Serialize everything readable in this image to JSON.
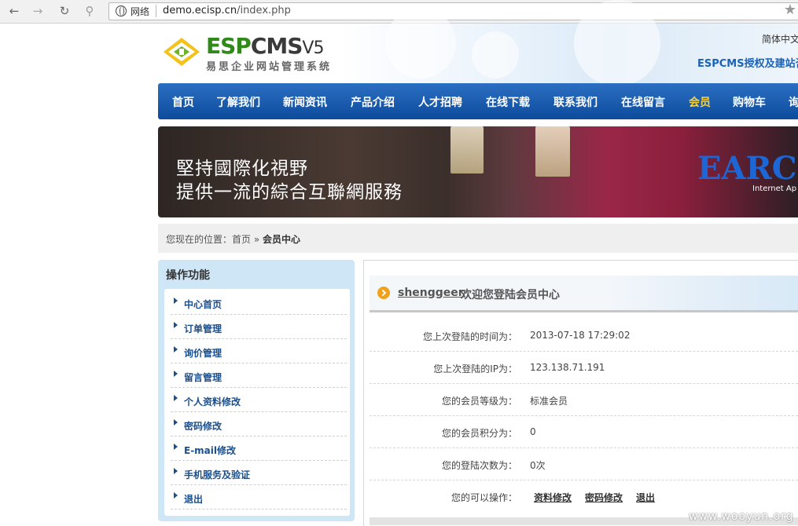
{
  "browser": {
    "site_label": "网络",
    "url_host": "demo.ecisp.cn",
    "url_path": "/index.php"
  },
  "header": {
    "logo_esp": "ESP",
    "logo_cms": "CMS",
    "logo_version": "V5",
    "logo_subtitle": "易思企业网站管理系统",
    "language": "简体中文",
    "auth_link": "ESPCMS授权及建站咨"
  },
  "nav": {
    "items": [
      {
        "label": "首页"
      },
      {
        "label": "了解我们"
      },
      {
        "label": "新闻资讯"
      },
      {
        "label": "产品介绍"
      },
      {
        "label": "人才招聘"
      },
      {
        "label": "在线下载"
      },
      {
        "label": "联系我们"
      },
      {
        "label": "在线留言"
      },
      {
        "label": "会员",
        "active": true
      },
      {
        "label": "购物车"
      },
      {
        "label": "询"
      }
    ],
    "active_color": "#f7d23b"
  },
  "banner": {
    "line1": "堅持國際化視野",
    "line2": "提供一流的綜合互聯網服務",
    "brand": "EARC",
    "brand_sub": "Internet Ap"
  },
  "breadcrumb": {
    "prefix": "您现在的位置：",
    "home": "首页",
    "sep": "»",
    "current": "会员中心"
  },
  "sidebar": {
    "title": "操作功能",
    "items": [
      {
        "label": "中心首页"
      },
      {
        "label": "订单管理"
      },
      {
        "label": "询价管理"
      },
      {
        "label": "留言管理"
      },
      {
        "label": "个人资料修改"
      },
      {
        "label": "密码修改"
      },
      {
        "label": "E-mail修改"
      },
      {
        "label": "手机服务及验证"
      },
      {
        "label": "退出"
      }
    ]
  },
  "main": {
    "username": "shenggeer",
    "welcome_msg": "欢迎您登陆会员中心",
    "rows": [
      {
        "label": "您上次登陆的时间为：",
        "value": "2013-07-18 17:29:02"
      },
      {
        "label": "您上次登陆的IP为：",
        "value": "123.138.71.191"
      },
      {
        "label": "您的会员等级为：",
        "value": "标准会员"
      },
      {
        "label": "您的会员积分为：",
        "value": "0"
      },
      {
        "label": "您的登陆次数为：",
        "value": "0次"
      }
    ],
    "ops_label": "您的可以操作：",
    "ops": [
      "资料修改",
      "密码修改",
      "退出"
    ]
  },
  "watermark": "www.wooyun.org",
  "colors": {
    "nav_blue": "#0d4b9c",
    "link_blue": "#1b4f8c",
    "sidebar_bg": "#cfe6f6"
  }
}
